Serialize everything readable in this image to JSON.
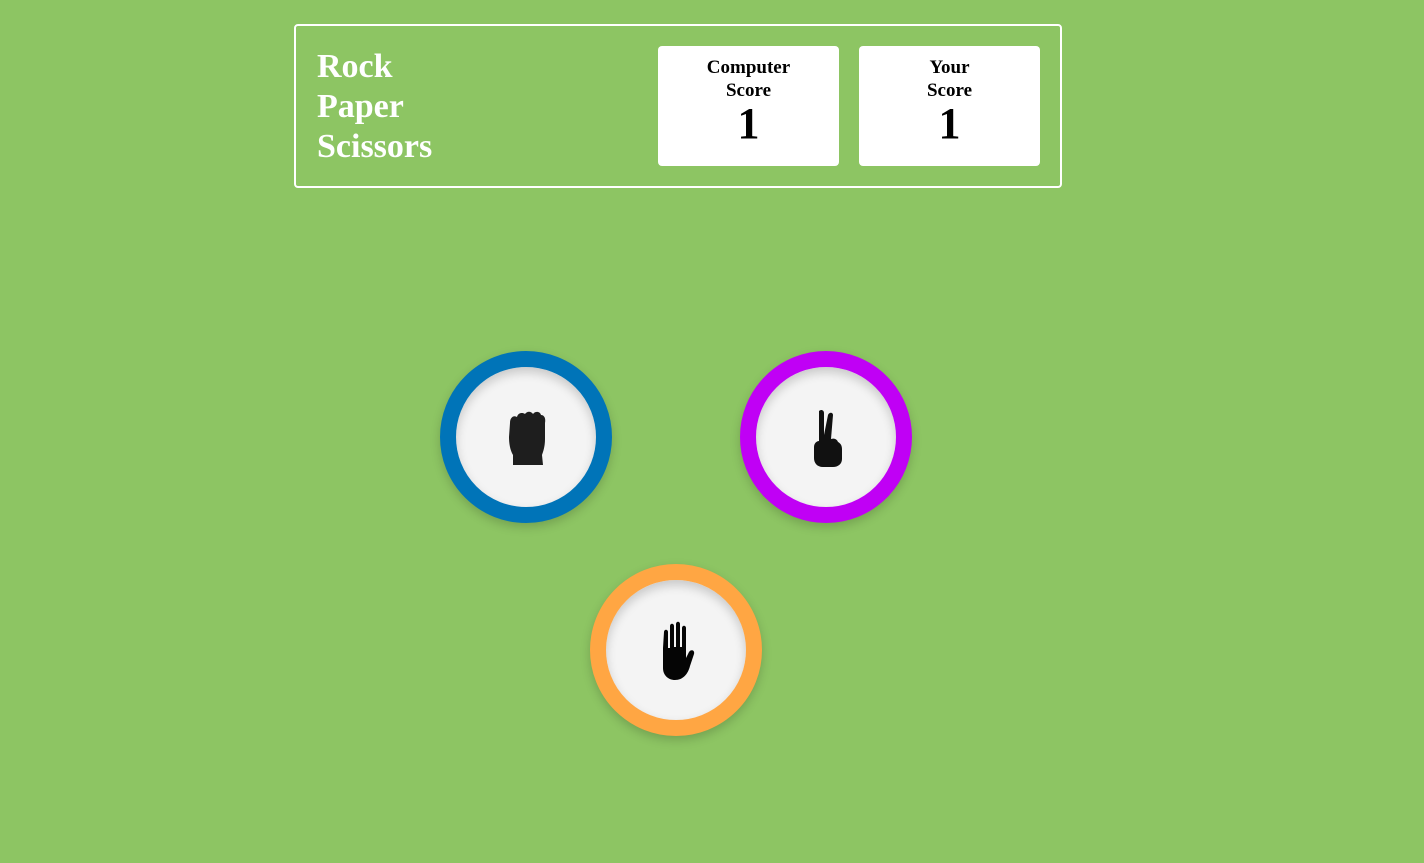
{
  "header": {
    "title_lines": [
      "Rock",
      "Paper",
      "Scissors"
    ]
  },
  "scores": {
    "computer": {
      "label_lines": [
        "Computer",
        "Score"
      ],
      "value": "1"
    },
    "player": {
      "label_lines": [
        "Your",
        "Score"
      ],
      "value": "1"
    }
  },
  "choices": [
    {
      "name": "rock",
      "icon": "fist-icon",
      "ring_color": "#0074b8"
    },
    {
      "name": "scissors",
      "icon": "peace-hand-icon",
      "ring_color": "#c000f5"
    },
    {
      "name": "paper",
      "icon": "open-hand-icon",
      "ring_color": "#ffa643"
    }
  ],
  "colors": {
    "background": "#8dc563",
    "header_border": "#ffffff"
  }
}
